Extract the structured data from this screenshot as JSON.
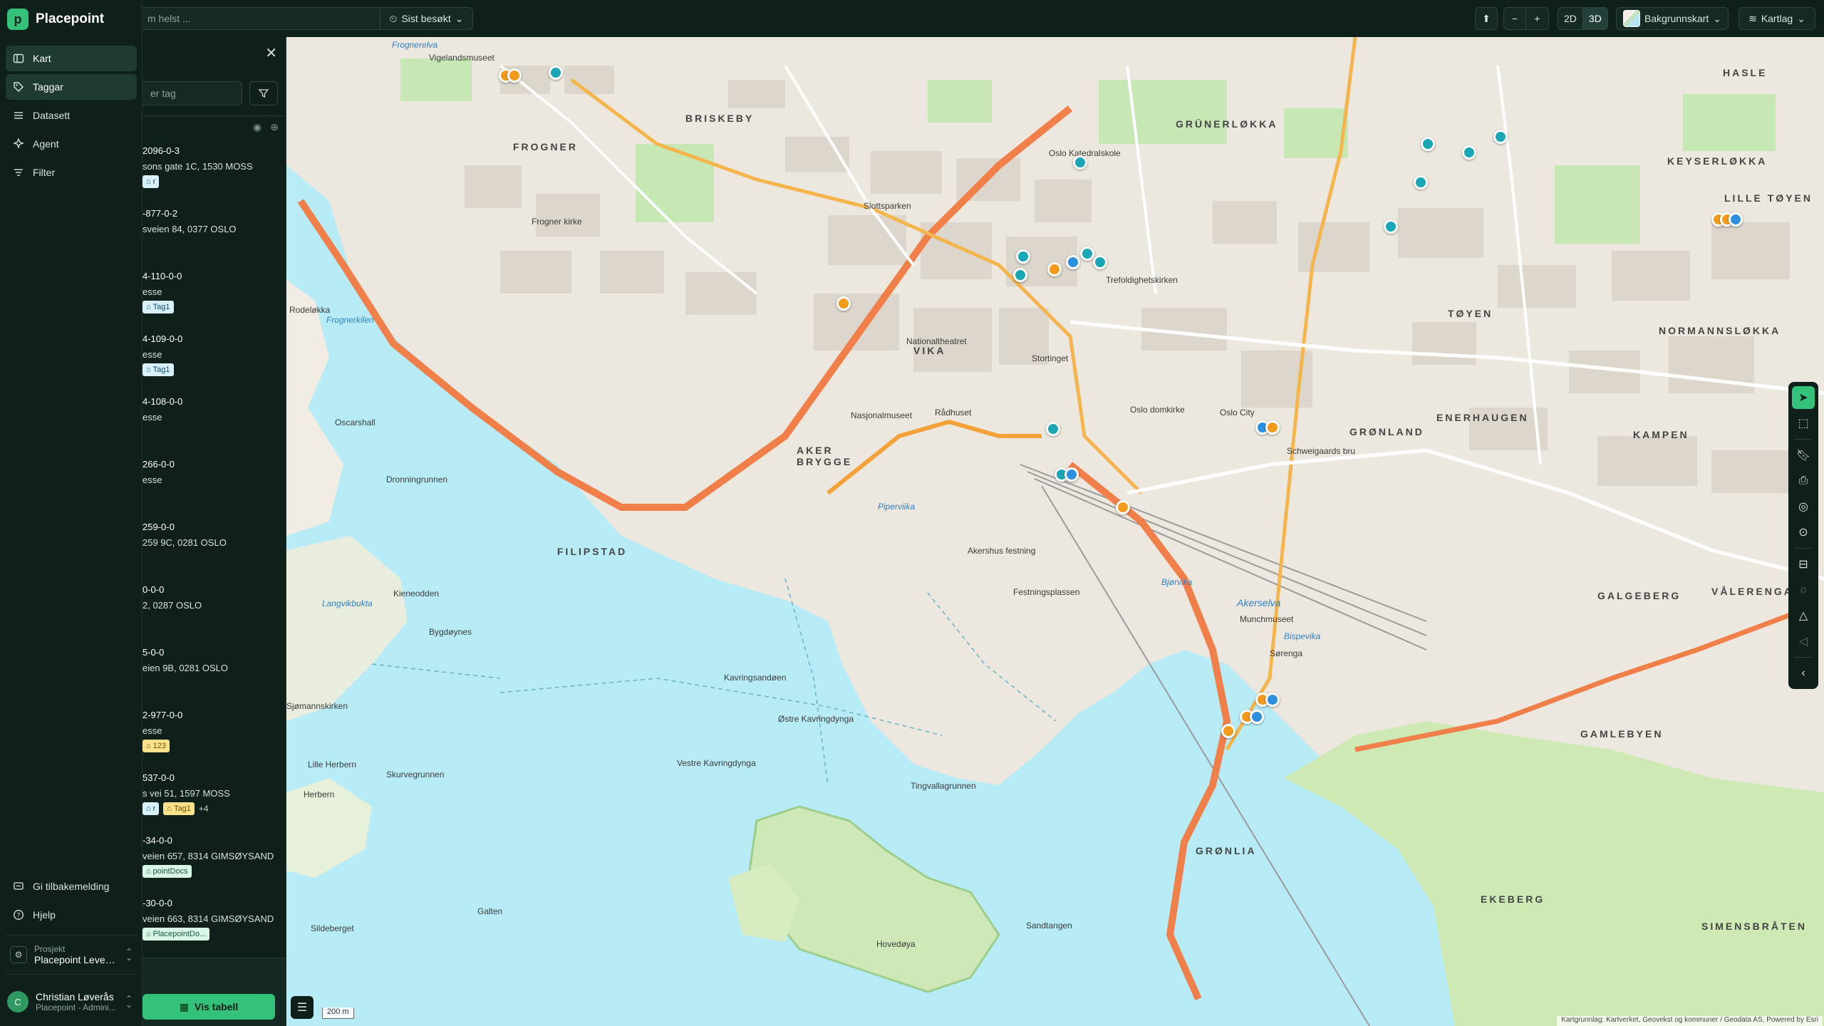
{
  "brand": {
    "name": "Placepoint",
    "logo_letter": "p"
  },
  "nav": {
    "items": [
      {
        "label": "Kart",
        "icon": "map-icon",
        "active": true
      },
      {
        "label": "Taggar",
        "icon": "tag-icon",
        "active": true
      },
      {
        "label": "Datasett",
        "icon": "list-icon",
        "active": false
      },
      {
        "label": "Agent",
        "icon": "sparkle-icon",
        "active": false
      },
      {
        "label": "Filter",
        "icon": "filter-icon",
        "active": false
      }
    ],
    "bottom": [
      {
        "label": "Gi tilbakemelding",
        "icon": "feedback-icon"
      },
      {
        "label": "Hjelp",
        "icon": "help-icon"
      }
    ],
    "project_label": "Prosjekt",
    "project_name": "Placepoint Leveri...",
    "user_initial": "C",
    "user_name": "Christian Løverås",
    "user_org": "Placepoint - Admini..."
  },
  "topbar": {
    "search_placeholder": "m helst ...",
    "recent_label": "Sist besøkt",
    "zoom_out": "−",
    "zoom_in": "+",
    "view_2d": "2D",
    "view_3d": "3D",
    "basemap_label": "Bakgrunnskart",
    "layers_label": "Kartlag"
  },
  "panel": {
    "search_placeholder": "er tag",
    "rows": [
      {
        "id": "2096-0-3",
        "addr": "sons gate 1C, 1530 MOSS",
        "tags": [
          {
            "label": "r",
            "color": "blue"
          }
        ]
      },
      {
        "id": "-877-0-2",
        "addr": "sveien 84, 0377 OSLO",
        "tags": []
      },
      {
        "id": "4-110-0-0",
        "addr": "esse",
        "tags": [
          {
            "label": "Tag1",
            "color": "blue"
          }
        ]
      },
      {
        "id": "4-109-0-0",
        "addr": "esse",
        "tags": [
          {
            "label": "Tag1",
            "color": "blue"
          }
        ]
      },
      {
        "id": "4-108-0-0",
        "addr": "esse",
        "tags": []
      },
      {
        "id": "266-0-0",
        "addr": "esse",
        "tags": []
      },
      {
        "id": "259-0-0",
        "addr": "259 9C, 0281 OSLO",
        "tags": []
      },
      {
        "id": "0-0-0",
        "addr": "2, 0287 OSLO",
        "tags": []
      },
      {
        "id": "5-0-0",
        "addr": "eien 9B, 0281 OSLO",
        "tags": []
      },
      {
        "id": "2-977-0-0",
        "addr": "esse",
        "tags": [
          {
            "label": "123",
            "color": "yellow"
          }
        ]
      },
      {
        "id": "537-0-0",
        "addr": "s vei 51, 1597 MOSS",
        "tags": [
          {
            "label": "r",
            "color": "blue"
          },
          {
            "label": "Tag1",
            "color": "yellow"
          }
        ],
        "more": "+4"
      },
      {
        "id": "-34-0-0",
        "addr": "veien 657, 8314 GIMSØYSAND",
        "tags": [
          {
            "label": "pointDocs",
            "color": "green"
          }
        ]
      },
      {
        "id": "-30-0-0",
        "addr": "veien 663, 8314 GIMSØYSAND",
        "tags": [
          {
            "label": "PlacepointDo...",
            "color": "green"
          }
        ]
      }
    ],
    "table_button": "Vis tabell"
  },
  "map": {
    "scale_label": "200 m",
    "attribution": "Kartgrunnlag: Kartverket, Geovekst og kommuner / Geodata AS, Powered by Esri",
    "districts": [
      "BRISKEBY",
      "FROGNER",
      "GRÜNERLØKKA",
      "KEYSERLØKKA",
      "HASLE",
      "LILLE TØYEN",
      "TØYEN",
      "NORMANNSLØKKA",
      "ENERHAUGEN",
      "GRØNLAND",
      "KAMPEN",
      "AKER BRYGGE",
      "VIKA",
      "FILIPSTAD",
      "VÅLERENGA",
      "GALGEBERG",
      "GAMLEBYEN",
      "GRØNLIA",
      "EKEBERG",
      "SIMENSBRÅTEN"
    ],
    "places": [
      "Frognerelva",
      "Vigelandsmuseet",
      "Frogner kirke",
      "Nationaltheatret",
      "Slottsparken",
      "Oslo Katedralskole",
      "Trefoldighetskirken",
      "Stortinget",
      "Rådhuset",
      "Nasjonalmuseet",
      "Oslo domkirke",
      "Oslo City",
      "Schweigaards bru",
      "Akershus festning",
      "Festningsplassen",
      "Kavringsandøen",
      "Østre Kavringdynga",
      "Vestre Kavringdynga",
      "Tingvallagrunnen",
      "Hovedøya",
      "Sandtangen",
      "Galten",
      "Sildeberget",
      "Herbern",
      "Skurvegrunnen",
      "Lille Herbern",
      "Sjømannskirken",
      "Bygdøynes",
      "Kieneodden",
      "Dronningrunnen",
      "Oscarshall",
      "Frognerkilen",
      "Rodeløkka",
      "Sørenga",
      "Munchmuseet",
      "Bjørvika",
      "Akerselva",
      "Bispevika",
      "Piperviika",
      "Langvikbukta"
    ]
  }
}
